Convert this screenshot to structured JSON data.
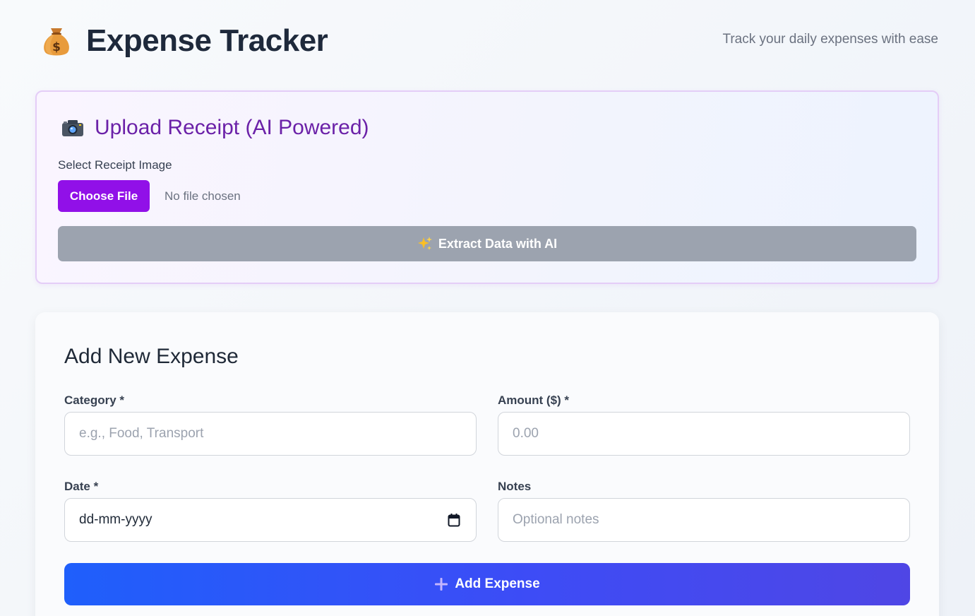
{
  "header": {
    "icon": "money-bag-icon",
    "title": "Expense Tracker",
    "tagline": "Track your daily expenses with ease"
  },
  "upload": {
    "icon": "camera-icon",
    "title": "Upload Receipt (AI Powered)",
    "file_label": "Select Receipt Image",
    "choose_file_label": "Choose File",
    "file_status": "No file chosen",
    "extract_icon": "sparkle-icon",
    "extract_label": "Extract Data with AI"
  },
  "expense_form": {
    "title": "Add New Expense",
    "category": {
      "label": "Category *",
      "placeholder": "e.g., Food, Transport",
      "value": ""
    },
    "amount": {
      "label": "Amount ($) *",
      "placeholder": "0.00",
      "value": ""
    },
    "date": {
      "label": "Date *",
      "placeholder": "dd-mm-yyyy",
      "icon": "calendar-icon"
    },
    "notes": {
      "label": "Notes",
      "placeholder": "Optional notes",
      "value": ""
    },
    "submit_icon": "plus-icon",
    "submit_label": "Add Expense"
  },
  "colors": {
    "upload_accent": "#6b21a8",
    "choose_file_bg": "#9110e8",
    "extract_disabled_bg": "#9ca3af",
    "submit_gradient_start": "#1f5ffb",
    "submit_gradient_end": "#4f46e5"
  }
}
